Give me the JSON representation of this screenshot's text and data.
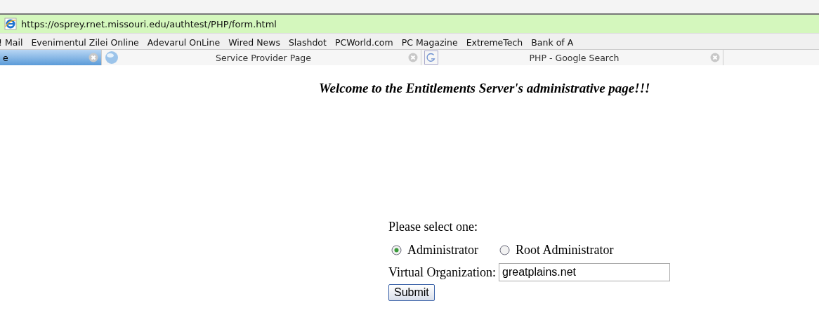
{
  "address_bar": {
    "url": "https://osprey.rnet.missouri.edu/authtest/PHP/form.html"
  },
  "bookmarks": [
    "! Mail",
    "Evenimentul Zilei Online",
    "Adevarul OnLine",
    "Wired News",
    "Slashdot",
    "PCWorld.com",
    "PC Magazine",
    "ExtremeTech",
    "Bank of A"
  ],
  "tabs": [
    {
      "title": "e",
      "selected": true,
      "kind": "plain"
    },
    {
      "title": "Service Provider Page",
      "selected": false,
      "kind": "globe"
    },
    {
      "title": "PHP - Google Search",
      "selected": false,
      "kind": "g"
    }
  ],
  "page": {
    "heading": "Welcome to the Entitlements Server's administrative page!!!",
    "prompt": "Please select one:",
    "options": [
      {
        "label": "Administrator",
        "selected": true
      },
      {
        "label": "Root Administrator",
        "selected": false
      }
    ],
    "field_label": "Virtual Organization:",
    "field_value": "greatplains.net",
    "submit": "Submit"
  }
}
